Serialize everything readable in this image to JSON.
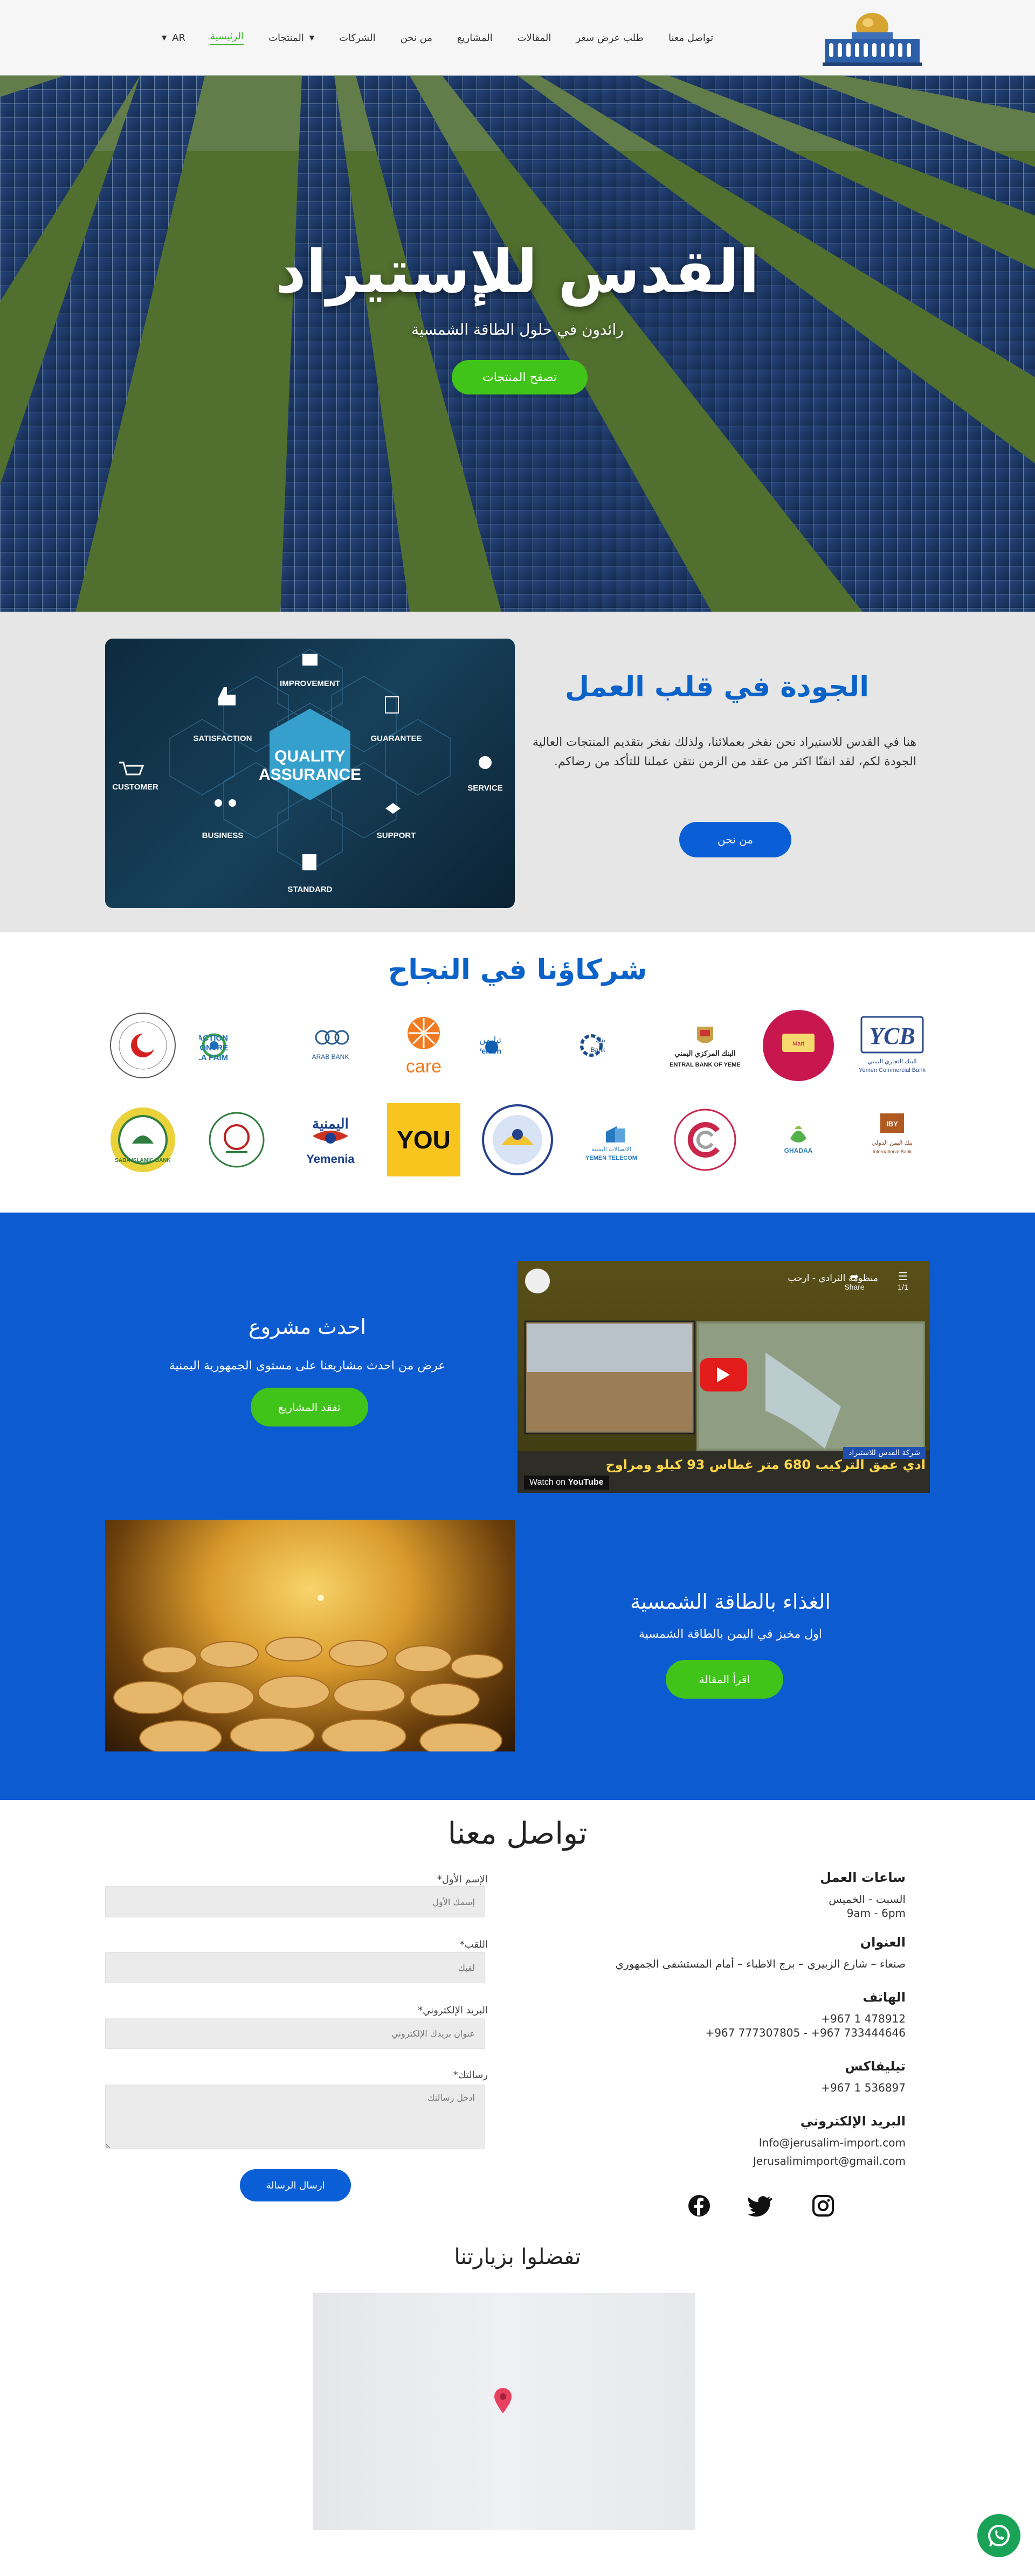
{
  "nav": {
    "lang": "AR",
    "items": [
      "الرئيسية",
      "المنتجات",
      "الشركات",
      "من نحن",
      "المشاريع",
      "المقالات",
      "طلب عرض سعر",
      "تواصل معنا"
    ]
  },
  "hero": {
    "title": "القدس للإستيراد",
    "subtitle": "رائدون في حلول الطاقة الشمسية",
    "button": "تصفح المنتجات"
  },
  "quality": {
    "title": "الجودة في قلب العمل",
    "text": "هنا في القدس للاستيراد نحن نفخر بعملائنا، ولذلك نفخر بتقديم المنتجات العالية الجودة لكم، لقد اتقنّا اكثر من عقد من الزمن نتقن عملنا للتأكد من رضاكم.",
    "button": "من نحن",
    "image_labels": {
      "improvement": "IMPROVEMENT",
      "satisfaction": "SATISFACTION",
      "guarantee": "GUARANTEE",
      "customer": "CUSTOMER",
      "service": "SERVICE",
      "business": "BUSINESS",
      "support": "SUPPORT",
      "standard": "STANDARD",
      "center_line1": "QUALITY",
      "center_line2": "ASSURANCE"
    }
  },
  "partners": {
    "title": "شركاؤنا في النجاح",
    "row1": [
      {
        "name": "red-crescent",
        "text": "THE RED CRESCENT"
      },
      {
        "name": "action-contre-la-faim",
        "text": "ACTION CONTRE LA FAIM"
      },
      {
        "name": "arab-bank",
        "text": "ARAB BANK"
      },
      {
        "name": "care",
        "text": "care"
      },
      {
        "name": "teleyemen",
        "text": "TeleYemen"
      },
      {
        "name": "sabafon",
        "text": "Sabafon Bank"
      },
      {
        "name": "central-bank",
        "text": "CENTRAL BANK OF YEMEN"
      },
      {
        "name": "yemeni-mart",
        "text": "Yemeni Mart"
      },
      {
        "name": "ycb",
        "text": "YCB"
      }
    ],
    "row2": [
      {
        "name": "saba-islamic-bank",
        "text": "SABA ISLAMIC BANK"
      },
      {
        "name": "association",
        "text": "جمعية"
      },
      {
        "name": "yemenia",
        "text": "Yemenia"
      },
      {
        "name": "you",
        "text": "YOU"
      },
      {
        "name": "cooperative",
        "text": "COOPERATIVE"
      },
      {
        "name": "yemen-telecom",
        "text": "YEMEN TELECOM"
      },
      {
        "name": "circle-c",
        "text": "C"
      },
      {
        "name": "ghadaa",
        "text": "GHADAA"
      },
      {
        "name": "international-bank",
        "text": "IBY"
      }
    ]
  },
  "projects": {
    "latest_title": "احدث مشروع",
    "latest_sub": "عرض من احدث مشاريعنا على مستوى الجمهورية اليمنية",
    "latest_button": "تفقد المشاريع",
    "video_title": "منظومة الثرادي - ارحب",
    "video_share": "Share",
    "video_count": "1/1",
    "video_caption": "ادي عمق التركيب 680 متر غطاس 93 كيلو ومراوح",
    "video_brand": "شركة القدس للاستيراد",
    "video_watch": "Watch on",
    "video_youtube": "YouTube",
    "food_title": "الغذاء بالطاقة الشمسية",
    "food_sub": "اول مخبز في اليمن بالطاقة الشمسية",
    "food_button": "اقرأ المقالة"
  },
  "contact": {
    "title": "تواصل معنا",
    "form": {
      "first_name_label": "الإسم الأول*",
      "first_name_placeholder": "إسمك الأول",
      "last_name_label": "اللقب*",
      "last_name_placeholder": "لقبك",
      "email_label": "البريد الإلكتروني*",
      "email_placeholder": "عنوان بريدك الإلكتروني",
      "message_label": "رسالتك*",
      "message_placeholder": "ادخل رسالتك",
      "submit": "ارسال الرسالة"
    },
    "info": {
      "hours_title": "ساعات العمل",
      "hours_days": "السبت - الخميس",
      "hours_time": "9am - 6pm",
      "address_title": "العنوان",
      "address": "صنعاء – شارع الزبيري – برج الاطباء – أمام المستشفى الجمهوري",
      "phone_title": "الهاتف",
      "phone1": "+967 1 478912",
      "phone2": "+967 777307805 - +967 733444646",
      "telefax_title": "تيليفاكس",
      "telefax": "+967 1 536897",
      "email_title": "البريد الإلكتروني",
      "email1": "Info@jerusalim-import.com",
      "email2": "Jerusalimimport@gmail.com"
    },
    "social": [
      "instagram-icon",
      "twitter-icon",
      "facebook-icon"
    ]
  },
  "visit": {
    "title": "تفضلوا بزيارتنا"
  },
  "colors": {
    "green": "#41c419",
    "blue": "#0c5bd1",
    "title_blue": "#0b63c9",
    "whatsapp": "#1aa257"
  }
}
